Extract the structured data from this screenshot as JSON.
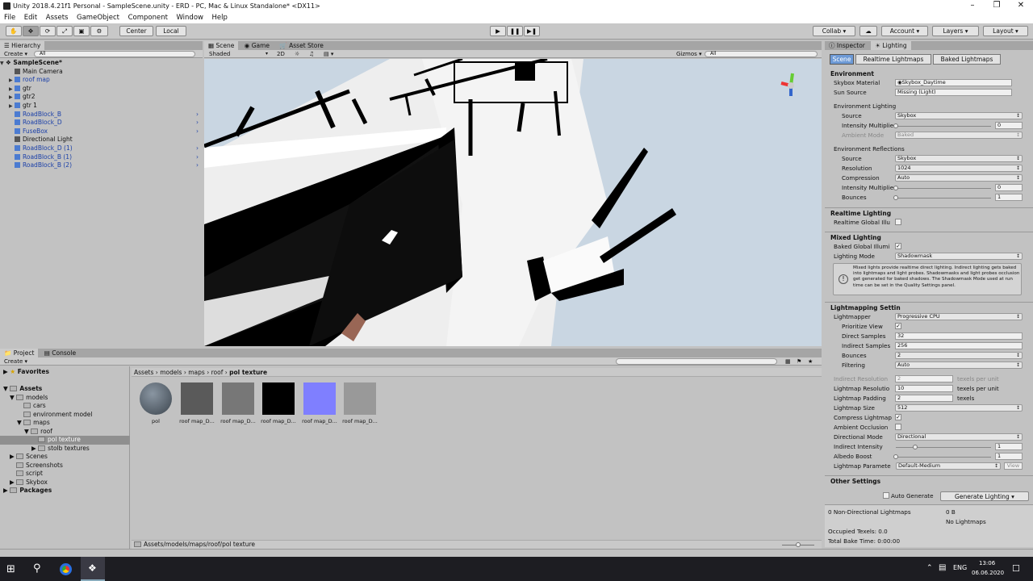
{
  "window": {
    "title": "Unity 2018.4.21f1 Personal - SampleScene.unity - ERD - PC, Mac & Linux Standalone* <DX11>"
  },
  "menu": [
    "File",
    "Edit",
    "Assets",
    "GameObject",
    "Component",
    "Window",
    "Help"
  ],
  "toolbar": {
    "center": "Center",
    "local": "Local",
    "collab": "Collab",
    "account": "Account",
    "layers": "Layers",
    "layout": "Layout"
  },
  "hierarchy": {
    "tab": "Hierarchy",
    "create": "Create",
    "search": "All",
    "scene": "SampleScene*",
    "items": [
      {
        "label": "Main Camera",
        "blue": false
      },
      {
        "label": "roof map",
        "blue": true
      },
      {
        "label": "gtr",
        "blue": false
      },
      {
        "label": "gtr2",
        "blue": false
      },
      {
        "label": "gtr 1",
        "blue": false
      },
      {
        "label": "RoadBlock_B",
        "blue": true
      },
      {
        "label": "RoadBlock_D",
        "blue": true
      },
      {
        "label": "FuseBox",
        "blue": true
      },
      {
        "label": "Directional Light",
        "blue": false
      },
      {
        "label": "RoadBlock_D (1)",
        "blue": true
      },
      {
        "label": "RoadBlock_B (1)",
        "blue": true
      },
      {
        "label": "RoadBlock_B (2)",
        "blue": true
      }
    ]
  },
  "sceneview": {
    "tabs": [
      "Scene",
      "Game",
      "Asset Store"
    ],
    "shading": "Shaded",
    "mode2d": "2D",
    "gizmos": "Gizmos",
    "search": "All"
  },
  "inspector": {
    "tabs": [
      "Inspector",
      "Lighting"
    ],
    "subtabs": [
      "Scene",
      "Realtime Lightmaps",
      "Baked Lightmaps"
    ],
    "environment": {
      "title": "Environment",
      "skybox_label": "Skybox Material",
      "skybox": "Skybox_Daytime",
      "sun_label": "Sun Source",
      "sun": "Missing (Light)",
      "lighting_title": "Environment Lighting",
      "source_label": "Source",
      "source": "Skybox",
      "intensity_label": "Intensity Multiplie",
      "intensity": "0",
      "ambient_label": "Ambient Mode",
      "ambient": "Baked",
      "refl_title": "Environment Reflections",
      "refl_source": "Skybox",
      "resolution_label": "Resolution",
      "resolution": "1024",
      "compression_label": "Compression",
      "compression": "Auto",
      "refl_intensity": "0",
      "bounces_label": "Bounces",
      "bounces": "1"
    },
    "realtime": {
      "title": "Realtime Lighting",
      "gi_label": "Realtime Global Illu"
    },
    "mixed": {
      "title": "Mixed Lighting",
      "baked_gi_label": "Baked Global Illumi",
      "mode_label": "Lighting Mode",
      "mode": "Shadowmask",
      "info": "Mixed lights provide realtime direct lighting. Indirect lighting gets baked into lightmaps and light probes. Shadowmasks and light probes occlusion get generated for baked shadows. The Shadowmask Mode used at run time can be set in the Quality Settings panel."
    },
    "lightmapping": {
      "title": "Lightmapping Settin",
      "lightmapper_label": "Lightmapper",
      "lightmapper": "Progressive CPU",
      "prioritize_label": "Prioritize View",
      "direct_label": "Direct Samples",
      "direct": "32",
      "indirect_label": "Indirect Samples",
      "indirect": "256",
      "bounces_label": "Bounces",
      "bounces": "2",
      "filtering_label": "Filtering",
      "filtering": "Auto",
      "ind_res_label": "Indirect Resolution",
      "ind_res": "2",
      "texels_per_unit": "texels per unit",
      "lm_res_label": "Lightmap Resolutio",
      "lm_res": "10",
      "lm_pad_label": "Lightmap Padding",
      "lm_pad": "2",
      "texels": "texels",
      "lm_size_label": "Lightmap Size",
      "lm_size": "512",
      "compress_label": "Compress Lightmap",
      "ao_label": "Ambient Occlusion",
      "dir_label": "Directional Mode",
      "dir": "Directional",
      "ind_int_label": "Indirect Intensity",
      "ind_int": "1",
      "albedo_label": "Albedo Boost",
      "albedo": "1",
      "params_label": "Lightmap Paramete",
      "params": "Default-Medium",
      "view": "View"
    },
    "other": {
      "title": "Other Settings",
      "auto_generate": "Auto Generate",
      "generate": "Generate Lighting"
    },
    "stats": {
      "nondir": "0 Non-Directional Lightmaps",
      "size": "0 B",
      "nolm": "No Lightmaps",
      "occupied": "Occupied Texels: 0.0",
      "bake_time": "Total Bake Time: 0:00:00"
    }
  },
  "project": {
    "tabs": [
      "Project",
      "Console"
    ],
    "create": "Create",
    "favorites": "Favorites",
    "assets": "Assets",
    "tree": [
      "models",
      "cars",
      "environment model",
      "maps",
      "roof",
      "pol texture",
      "stolb textures",
      "Scenes",
      "Screenshots",
      "script",
      "Skybox"
    ],
    "packages": "Packages",
    "breadcrumb": [
      "Assets",
      "models",
      "maps",
      "roof",
      "pol texture"
    ],
    "items": [
      {
        "label": "pol",
        "color": "#4a5560"
      },
      {
        "label": "roof map_D...",
        "color": "#5a5a5a"
      },
      {
        "label": "roof map_D...",
        "color": "#777777"
      },
      {
        "label": "roof map_D...",
        "color": "#000000"
      },
      {
        "label": "roof map_D...",
        "color": "#7f7fff"
      },
      {
        "label": "roof map_D...",
        "color": "#999999"
      }
    ],
    "path": "Assets/models/maps/roof/pol texture"
  },
  "taskbar": {
    "lang": "ENG",
    "time": "13:06",
    "date": "06.06.2020"
  }
}
